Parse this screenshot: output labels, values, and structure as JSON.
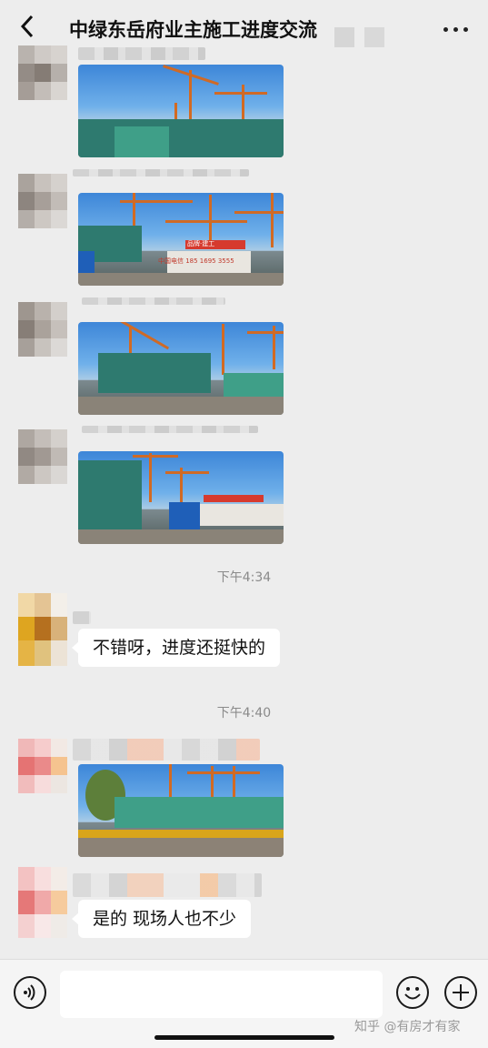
{
  "header": {
    "title": "中绿东岳府业主施工进度交流"
  },
  "messages": [
    {
      "type": "image",
      "desc": "construction-site-photo"
    },
    {
      "type": "image",
      "desc": "construction-site-photo"
    },
    {
      "type": "image",
      "desc": "construction-site-photo"
    },
    {
      "type": "image",
      "desc": "construction-site-photo"
    }
  ],
  "timestamps": [
    "下午4:34",
    "下午4:40"
  ],
  "texts": {
    "msg1": "不错呀，进度还挺快的",
    "msg2": "是的 现场人也不少"
  },
  "photo_text": {
    "banner": "品牌·建工",
    "phone": "中国电信 185 1695 3555"
  },
  "watermark": "知乎 @有房才有家",
  "colors": {
    "background": "#ededed",
    "bubble": "#ffffff",
    "bottom_bar": "#f5f5f5"
  }
}
